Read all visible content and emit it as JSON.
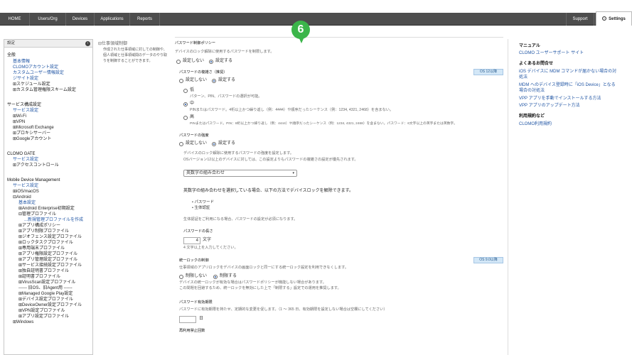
{
  "nav": {
    "items": [
      "HOME",
      "Users/Org",
      "Devices",
      "Applications",
      "Reports"
    ],
    "support": "Support",
    "settings": "Settings"
  },
  "step": "6",
  "sidebar": {
    "header": "設定",
    "general": {
      "title": "全般",
      "items": [
        "基本情報",
        "CLOMOアカウント設定",
        "カスタムユーザー情報設定",
        "ジサイト設定",
        "スケジュール設定",
        "カスタム管理権限スキーム設定"
      ]
    },
    "services": {
      "title": "サービス構成設定",
      "items": [
        "サービス設定",
        "Wi-Fi",
        "VPN",
        "Microsoft Exchange",
        "プロキシサーバー",
        "Googleアカウント"
      ]
    },
    "gate": {
      "title": "CLOMO GATE",
      "items": [
        "サービス設定",
        "アクセスコントロール"
      ]
    },
    "mdm": {
      "title": "Mobile Device Management",
      "items": [
        "サービス設定",
        "iOS/macOS",
        "Android",
        "基本設定",
        "Android Enterprise初期設定",
        "管理プロファイル",
        "...新規管理プロファイルを作成",
        "アプリ構成ポリシー",
        "アプリ制限プロファイル",
        "ジオフェンス設定プロファイル",
        "ロックタスクプロファイル",
        "専用端末プロファイル",
        "アプリ権限設定プロファイル",
        "アプリ管理設定プロファイル",
        "サービス接続設定プロファイル",
        "独自証明書プロファイル",
        "証明書プロファイル",
        "VirusScan設定プロファイル",
        "------ 旧OS、旧Agent用 ------",
        "Managed Google Play設定",
        "デバイス設定プロファイル",
        "DeviceOwner設定プロファイル",
        "VPN設定プロファイル",
        "アプリ設定プロファイル",
        "Windows"
      ]
    }
  },
  "desc": {
    "title": "仕事領域制御",
    "text": [
      "作成された仕事領域に対しての制御や、",
      "個人領域と仕事領域間のデータのやり取",
      "りを制御することができます。"
    ]
  },
  "main": {
    "policy_title": "パスワード制御ポリシー",
    "policy_desc": "デバイスのロック解除に使用するパスワードを制限します。",
    "no_set": "設定しない",
    "set": "設定する",
    "complexity_title": "パスワードの複雑さ（推奨）",
    "os12": "OS 12以降",
    "low": "低",
    "low_desc": "パターン、PIN、パスワードの選択が可能。",
    "mid": "中",
    "mid_desc": "PINまたはパスワード。4桁以上かつ繰り返し（例：4444）や順序だったシーケンス（例：1234, 4321, 2468）を含まない。",
    "high": "高",
    "high_desc": "PINまたはパスワード。PIN：8桁以上かつ繰り返し（例：4444）や順序だったシーケンス（例：1234, 4321, 2468）を含まない。パスワード：6文字以上の英字または英数字。",
    "strength_title": "パスワードの強度",
    "strength_desc1": "デバイスのロック解除に使用するパスワードの強度を設定します。",
    "strength_desc2": "OSバージョン12以上のデバイスに対しては、この設定よりもパスワードの複雑さの設定が優先されます。",
    "strength_value": "英数字の組み合わせ",
    "combo_note": "英数字の組み合わせを選択している場合、以下の方法でデバイスロックを解除できます。",
    "bullets": [
      "パスワード",
      "生体認証"
    ],
    "bio_note": "生体認証をご利用になる場合、パスワードの設定が必須になります。",
    "length_title": "パスワードの長さ",
    "length_value": "4",
    "length_unit": "文字",
    "length_note": "4 文字以上を入力してください。",
    "unified_title": "統一ロックの制御",
    "os9": "OS 9.0以降",
    "unified_desc": "仕事領域のアプリロックをデバイスの画面ロックと同一にする統一ロック設定を利用できなくします。",
    "unified_no": "制限しない",
    "unified_yes": "制限する",
    "unified_note1": "デバイスの統一ロックが有効な場合はパスワードポリシーが機能しない場合があります。",
    "unified_note2": "この問題を回避するため、統一ロックを無効にした上で「制限する」設定での運用を推奨します。",
    "expiry_title": "パスワード有効期限",
    "expiry_desc": "パスワードに有効期限を持たせ、定期的な変更を促します。（1 ～ 365 日、有効期限を設定しない場合は空欄にしてください）",
    "expiry_unit": "日",
    "reuse_title": "再利用禁止回数"
  },
  "right": {
    "manual_title": "マニュアル",
    "manual_link": "CLOMO ユーザーサポート サイト",
    "faq_title": "よくあるお問合せ",
    "faq_links": [
      "iOS デバイスに MDM コマンドが届かない場合の対",
      "処法",
      "MDM へのデバイス登録時に「iOS Device」となる",
      "場合の対処法",
      "VPP アプリを手動でインストールする方法",
      "VPP アプリのアップデート方法"
    ],
    "terms_title": "利用規約など",
    "terms_link": "CLOMO利用規約"
  },
  "colors": {
    "link": "#2055a4",
    "topbar": "#4d4d4d",
    "step": "#3bb54a",
    "badge": "#d3e7f7"
  }
}
